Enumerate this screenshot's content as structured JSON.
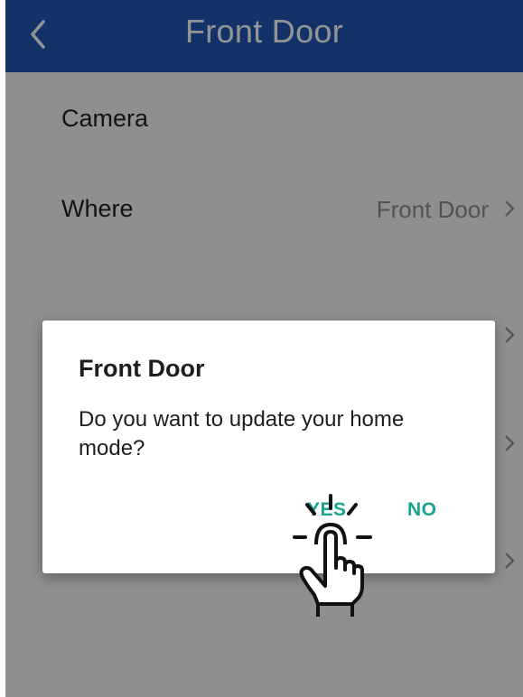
{
  "header": {
    "title": "Front Door",
    "back_icon": "chevron-left-icon",
    "background_color": "#1f57b3"
  },
  "settings": {
    "rows": [
      {
        "label": "Camera",
        "value": ""
      },
      {
        "label": "Where",
        "value": "Front Door"
      }
    ]
  },
  "dialog": {
    "title": "Front Door",
    "message": "Do you want to update your home mode?",
    "yes_label": "YES",
    "no_label": "NO",
    "button_color": "#1aa38e"
  },
  "overlay": {
    "tap_indicator_icon": "tap-hand-icon"
  }
}
